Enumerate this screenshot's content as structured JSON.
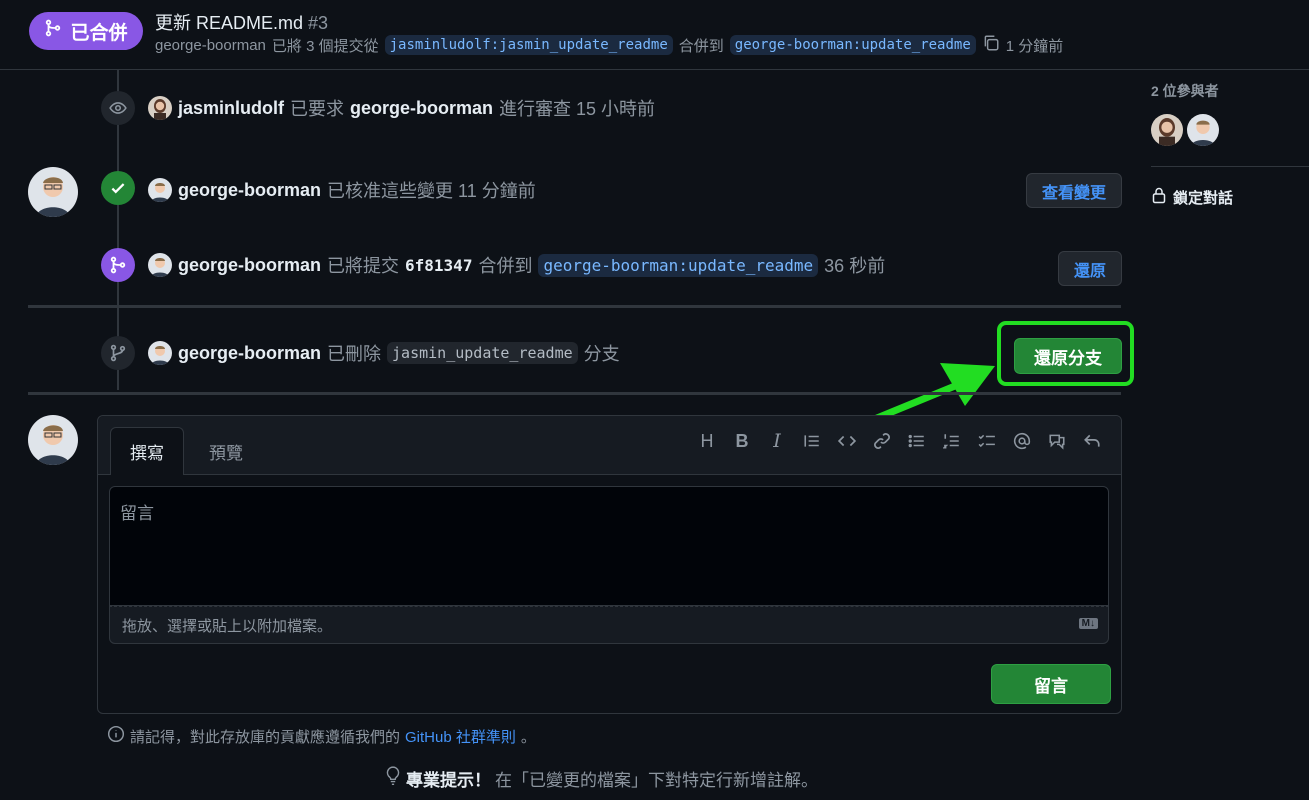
{
  "header": {
    "state_label": "已合併",
    "title": "更新 README.md",
    "pr_number": "#3",
    "subtitle": {
      "author": "george-boorman",
      "action": "已將 3 個提交從",
      "from_branch": "jasminludolf:jasmin_update_readme",
      "merged_into": "合併到",
      "to_branch": "george-boorman:update_readme",
      "time": "1 分鐘前"
    }
  },
  "timeline": [
    {
      "user": "jasminludolf",
      "action": "已要求",
      "target": "george-boorman",
      "suffix": "進行審查 15 小時前"
    },
    {
      "user": "george-boorman",
      "action": "已核准這些變更 11 分鐘前",
      "button": "查看變更"
    },
    {
      "user": "george-boorman",
      "action": "已將提交",
      "commit": "6f81347",
      "merged_into": "合併到",
      "branch": "george-boorman:update_readme",
      "time": "36 秒前",
      "button": "還原"
    },
    {
      "user": "george-boorman",
      "action": "已刪除",
      "branch": "jasmin_update_readme",
      "suffix": "分支",
      "button": "還原分支"
    }
  ],
  "comment": {
    "tab_write": "撰寫",
    "tab_preview": "預覽",
    "placeholder": "留言",
    "dropzone": "拖放、選擇或貼上以附加檔案。",
    "markdown_badge": "M↓",
    "submit": "留言",
    "toolbar": [
      "H",
      "B",
      "I"
    ]
  },
  "notice": {
    "text": "請記得，對此存放庫的貢獻應遵循我們的",
    "link": "GitHub 社群準則",
    "end": "。"
  },
  "protip": {
    "label": "專業提示！",
    "text": "在「已變更的檔案」下對特定行新增註解。"
  },
  "sidebar": {
    "participants_title": "2 位參與者",
    "lock_label": "鎖定對話"
  },
  "colors": {
    "merged_purple": "#8957e5",
    "approve_green": "#238636",
    "annotation_green": "#22dd22",
    "link_blue": "#4493f8"
  }
}
